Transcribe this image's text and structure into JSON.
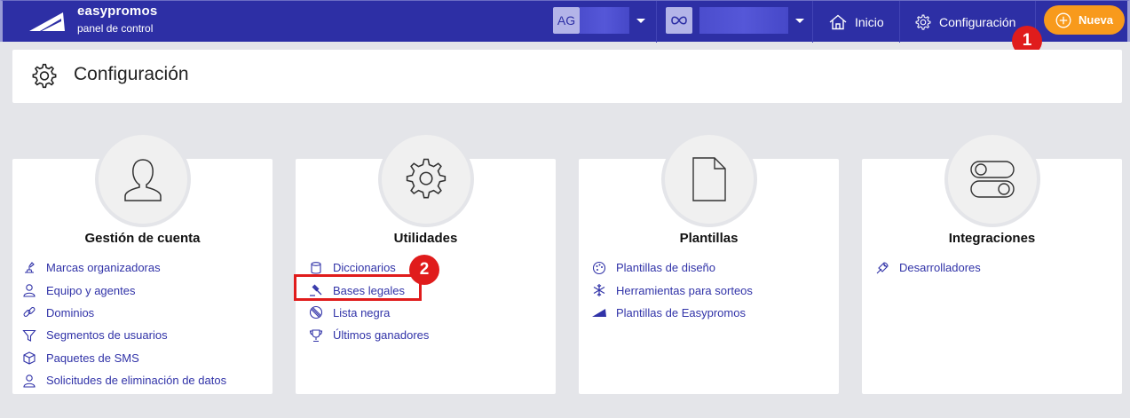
{
  "brand": {
    "name": "easypromos",
    "subtitle": "panel de control"
  },
  "org_switcher": {
    "initials": "AG"
  },
  "promo_switcher": {
    "icon": "infinity-icon"
  },
  "nav": {
    "home_label": "Inicio",
    "settings_label": "Configuración",
    "new_label": "Nueva"
  },
  "markers": [
    "1",
    "2"
  ],
  "page": {
    "title": "Configuración"
  },
  "cards": [
    {
      "title": "Gestión de cuenta",
      "icon": "user-icon",
      "items": [
        "Marcas organizadoras",
        "Equipo y agentes",
        "Dominios",
        "Segmentos de usuarios",
        "Paquetes de SMS",
        "Solicitudes de eliminación de datos"
      ]
    },
    {
      "title": "Utilidades",
      "icon": "cog-icon",
      "items": [
        "Diccionarios",
        "Bases legales",
        "Lista negra",
        "Últimos ganadores"
      ]
    },
    {
      "title": "Plantillas",
      "icon": "document-icon",
      "items": [
        "Plantillas de diseño",
        "Herramientas para sorteos",
        "Plantillas de Easypromos"
      ]
    },
    {
      "title": "Integraciones",
      "icon": "toggles-icon",
      "items": [
        "Desarrolladores"
      ]
    }
  ],
  "colors": {
    "navbar": "#2d2fa5",
    "accent": "#f89a1c",
    "link": "#3133a8",
    "marker": "#e01c1c"
  }
}
